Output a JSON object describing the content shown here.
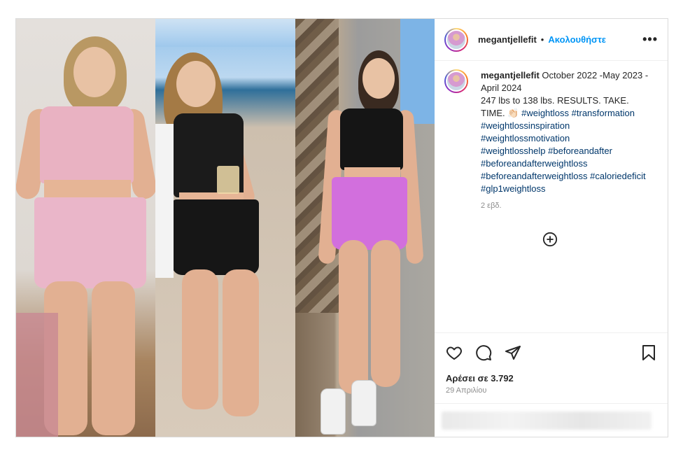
{
  "post": {
    "username": "megantjellefit",
    "follow_label": "Ακολουθήστε",
    "separator": "•",
    "more_label": "•••",
    "caption": {
      "username": "megantjellefit",
      "text_line1": " October 2022 -May 2023 -April 2024",
      "text_line2": "247 lbs to 138 lbs. RESULTS. TAKE. TIME. 👏🏻",
      "hashtags": [
        "#weightloss",
        "#transformation",
        "#weightlossinspiration",
        "#weightlossmotivation",
        "#weightlosshelp",
        "#beforeandafter",
        "#beforeandafterweightloss",
        "#beforeandafterweightloss",
        "#caloriedeficit",
        "#glp1weightloss"
      ],
      "time_ago": "2 εβδ."
    },
    "likes": "Αρέσει σε 3.792",
    "date": "29 Απριλίου"
  },
  "colors": {
    "accent": "#0095f6",
    "hashtag": "#00376b",
    "muted": "#8e8e8e",
    "border": "#dbdbdb"
  },
  "icons": {
    "like": "heart-icon",
    "comment": "comment-icon",
    "share": "paper-plane-icon",
    "save": "bookmark-icon",
    "add": "plus-circle-icon",
    "more": "more-options-icon"
  }
}
